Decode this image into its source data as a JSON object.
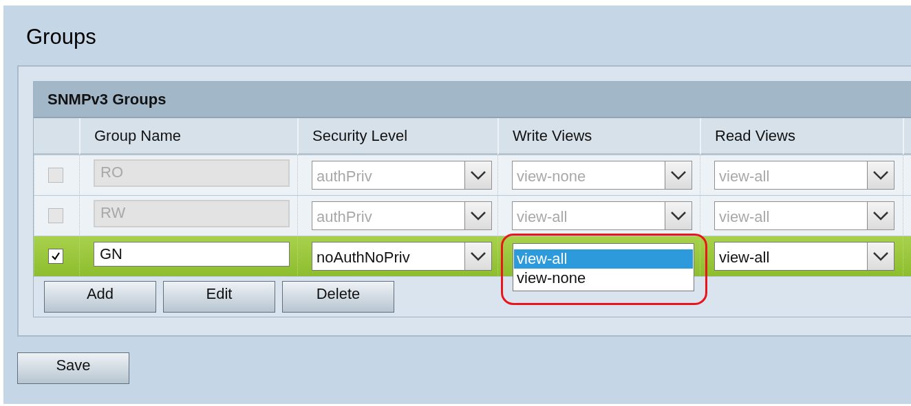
{
  "page": {
    "title": "Groups"
  },
  "table": {
    "title": "SNMPv3 Groups",
    "columns": [
      "Group Name",
      "Security Level",
      "Write Views",
      "Read Views"
    ],
    "rows": [
      {
        "checked": false,
        "disabled": true,
        "selected": false,
        "group_name": "RO",
        "security_level": "authPriv",
        "write_views": "view-none",
        "read_views": "view-all"
      },
      {
        "checked": false,
        "disabled": true,
        "selected": false,
        "group_name": "RW",
        "security_level": "authPriv",
        "write_views": "view-all",
        "read_views": "view-all"
      },
      {
        "checked": true,
        "disabled": false,
        "selected": true,
        "group_name": "GN",
        "security_level": "noAuthNoPriv",
        "write_views_menu": {
          "highlighted": true,
          "options": [
            {
              "label": "view-all",
              "selected": true
            },
            {
              "label": "view-none",
              "selected": false
            }
          ]
        },
        "read_views": "view-all"
      }
    ]
  },
  "buttons": [
    "Add",
    "Edit",
    "Delete"
  ],
  "save_button": "Save"
}
